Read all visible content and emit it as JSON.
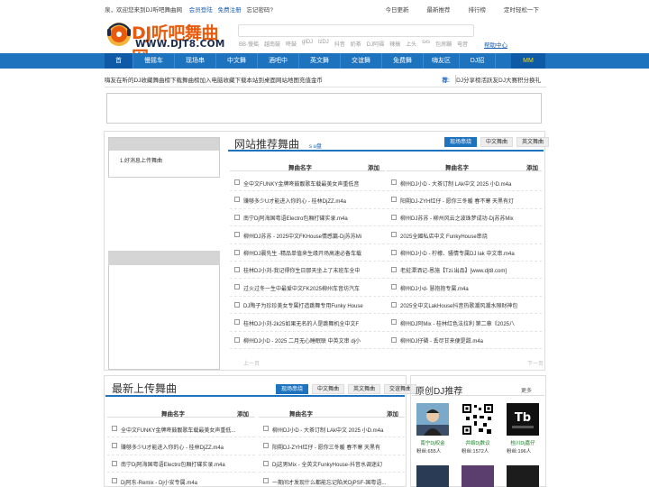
{
  "topbar": {
    "welcome": "泉，欢迎您来到DJ听吧舞曲网",
    "login": "会员登陆",
    "register": "免费注册",
    "forgot": "忘记密码?",
    "links": [
      "今日更新",
      "最新推荐",
      "排行榜",
      "定时轻松一下"
    ]
  },
  "logo": {
    "title": "DJ听吧舞曲网",
    "url": "WWW.DJT8.COM"
  },
  "search": {
    "hotwords": [
      "BB·慢摇",
      "越南鼓",
      "咚鼓",
      "glDJ",
      "lzDJ",
      "抖音",
      "奶茶",
      "DJ阿福",
      "辣搞",
      "上头",
      "sxs",
      "包房蹦",
      "电音"
    ],
    "help": "帮助中心"
  },
  "nav": {
    "items": [
      "首 页",
      "慢摇车载",
      "现场串烧",
      "中文舞曲",
      "酒吧中文",
      "英文舞曲",
      "交谊舞曲",
      "免费舞曲",
      "嗨友区",
      "DJ招募"
    ],
    "mm": "MM"
  },
  "subnav": {
    "left": [
      "嗨友在听的DJ",
      "收藏舞曲榜",
      "下载舞曲榜",
      "加入电脑收藏",
      "下载本站到桌面",
      "网站地图",
      "充值金币"
    ],
    "right_label": "荐:",
    "right": [
      "DJ分享榜",
      "活跃友",
      "DJ大赛",
      "积分换礼"
    ]
  },
  "side": {
    "item1": "1.好消息上传舞曲"
  },
  "recommend": {
    "title": "网站推荐舞曲",
    "icon_links": [
      "s",
      "u盘"
    ],
    "tabs": [
      "现场串烧",
      "中文舞曲",
      "英文舞曲"
    ],
    "col_name": "舞曲名字",
    "col_add": "添加",
    "left_rows": [
      "全中文FUNKY金牌咚鼓靓歌车载最美女声重低音",
      "赚够多少U才能进入你的心 - 桂林DjZZ.m4a",
      "南宁Dj阿海国粤语Electro包厢打碟实录.m4a",
      "柳州DJ苏苏 - 2025中文FKHouse情感篇-Dj苏苏Mi",
      "柳州DJ晨先生 -精品单值来生缘开场高速必备车载",
      "桂林DJ小刘-我记得你生日那天坐上了末班车全中",
      "过火过冬一生中最爱中文FK2025柳州车音坊汽车",
      "DJ陶子为珍珍美女专属打造跳舞专用Funky House",
      "桂林DJ小刘-2k25如果无名的人是跳舞机全中文F",
      "柳州DJ小D - 2025 二月无心睡眠联 中英文串 dj小"
    ],
    "right_rows": [
      "柳州DJ小D - 大茶订制 LAk中文 2025 小D.m4a",
      "阳朔DJ-ZYH红仔 - 愿你三冬暖 春不寒 天黑有灯",
      "柳州DJ苏苏 - 柳州风云之波珠梦成功-Dj苏苏Mix",
      "2025全國私店中文 FunkyHouse串烧",
      "柳州DJ小D - 柠檬、骚情专属DJ lak 中文串.m4a",
      "老挝潭洒记-恩施【Tzi.出品】[www.djt8.com]",
      "柳州DJ小d- 慧抱抱专属.m4a",
      "2025全中文LakHouse抖音热歌潮风潮水隙财神包",
      "柳州DJ阿Mix - 桂林红色法拉利 第二章《2025八",
      "柳州DJ仔磷 - 丢尽甘来便是甜.m4a"
    ],
    "pager_left": "上一页",
    "pager_right": "下一页"
  },
  "newup": {
    "title": "最新上传舞曲",
    "tabs": [
      "现场串烧",
      "中文舞曲",
      "英文舞曲",
      "交谊舞曲"
    ],
    "col_name": "舞曲名字",
    "col_add": "添加",
    "left_rows": [
      "全中文FUNKY金牌咚鼓靓歌车载最美女声重低...",
      "赚够多少U才能进入你的心 - 桂林DjZZ.m4a",
      "南宁Dj阿海国粤语Electro包厢打碟实录.m4a",
      "Dj阿东-Remix - Dj小安专属.m4a"
    ],
    "right_rows": [
      "柳州DJ小D - 大茶订制 LAk中文 2025 小D.m4a",
      "阳朔DJ-ZYH红仔 - 愿你三冬暖 春不寒 天黑有",
      "Dj这男Mix - 全英文FunkyHouse-抖音水调迷幻",
      "一期间才发现什么都能忘记陷关DjPSF-国粤语..."
    ]
  },
  "orig": {
    "title": "原创DJ推荐",
    "more": "更多",
    "djs": [
      {
        "name": "南宁Dj权金",
        "fans": "粉丝:655人"
      },
      {
        "name": "井络Dj数议",
        "fans": "粉丝:1572人"
      },
      {
        "name": "桂川Dj嘉仔",
        "fans": "粉丝:196人"
      }
    ]
  }
}
